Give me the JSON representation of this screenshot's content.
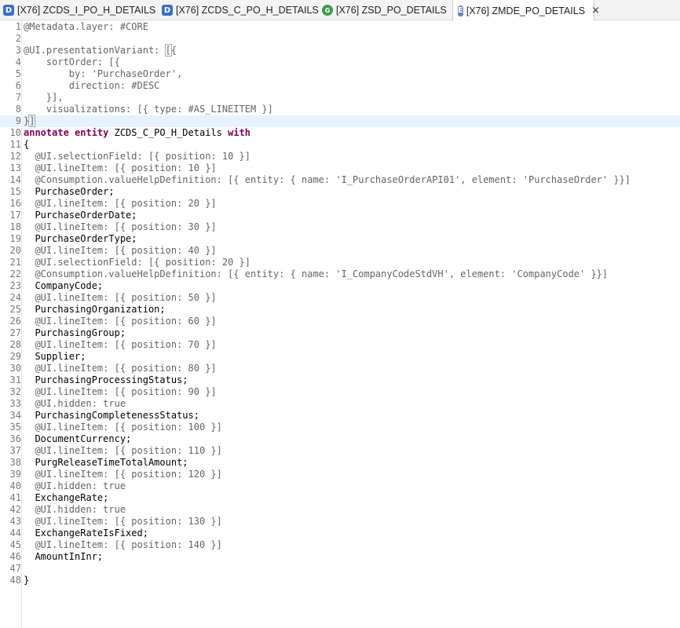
{
  "tabs": [
    {
      "icon": "D",
      "label": "[X76] ZCDS_I_PO_H_DETAILS",
      "active": false
    },
    {
      "icon": "D",
      "label": "[X76] ZCDS_C_PO_H_DETAILS",
      "active": false
    },
    {
      "icon": "G",
      "label": "[X76] ZSD_PO_DETAILS",
      "active": false
    },
    {
      "icon": "E",
      "label": "[X76] ZMDE_PO_DETAILS",
      "active": true
    }
  ],
  "tab_close_glyph": "×",
  "lines": [
    {
      "n": "1",
      "t": [
        [
          "anno",
          "@Metadata.layer: #CORE"
        ]
      ]
    },
    {
      "n": "2",
      "t": []
    },
    {
      "n": "3",
      "t": [
        [
          "anno",
          "@UI.presentationVariant: "
        ],
        [
          "anno",
          "["
        ],
        [
          "anno",
          "{"
        ]
      ]
    },
    {
      "n": "4",
      "t": [
        [
          "anno",
          "    sortOrder: [{"
        ]
      ]
    },
    {
      "n": "5",
      "t": [
        [
          "anno",
          "        by: 'PurchaseOrder',"
        ]
      ]
    },
    {
      "n": "6",
      "t": [
        [
          "anno",
          "        direction: #DESC"
        ]
      ]
    },
    {
      "n": "7",
      "t": [
        [
          "anno",
          "    }],"
        ]
      ]
    },
    {
      "n": "8",
      "t": [
        [
          "anno",
          "    visualizations: [{ type: #AS_LINEITEM }]"
        ]
      ]
    },
    {
      "n": "9",
      "t": [
        [
          "anno",
          "}"
        ],
        [
          "anno",
          "]"
        ]
      ]
    },
    {
      "n": "10",
      "t": [
        [
          "kw",
          "annotate entity"
        ],
        [
          "plain",
          " ZCDS_C_PO_H_Details "
        ],
        [
          "kw",
          "with"
        ]
      ]
    },
    {
      "n": "11",
      "t": [
        [
          "plain",
          "{"
        ]
      ]
    },
    {
      "n": "12",
      "t": [
        [
          "anno",
          "  @UI.selectionField: [{ position: 10 }]"
        ]
      ]
    },
    {
      "n": "13",
      "t": [
        [
          "anno",
          "  @UI.lineItem: [{ position: 10 }]"
        ]
      ]
    },
    {
      "n": "14",
      "t": [
        [
          "anno",
          "  @Consumption.valueHelpDefinition: [{ entity: { name: 'I_PurchaseOrderAPI01', element: 'PurchaseOrder' }}]"
        ]
      ]
    },
    {
      "n": "15",
      "t": [
        [
          "plain",
          "  PurchaseOrder;"
        ]
      ]
    },
    {
      "n": "16",
      "t": [
        [
          "anno",
          "  @UI.lineItem: [{ position: 20 }]"
        ]
      ]
    },
    {
      "n": "17",
      "t": [
        [
          "plain",
          "  PurchaseOrderDate;"
        ]
      ]
    },
    {
      "n": "18",
      "t": [
        [
          "anno",
          "  @UI.lineItem: [{ position: 30 }]"
        ]
      ]
    },
    {
      "n": "19",
      "t": [
        [
          "plain",
          "  PurchaseOrderType;"
        ]
      ]
    },
    {
      "n": "20",
      "t": [
        [
          "anno",
          "  @UI.lineItem: [{ position: 40 }]"
        ]
      ]
    },
    {
      "n": "21",
      "t": [
        [
          "anno",
          "  @UI.selectionField: [{ position: 20 }]"
        ]
      ]
    },
    {
      "n": "22",
      "t": [
        [
          "anno",
          "  @Consumption.valueHelpDefinition: [{ entity: { name: 'I_CompanyCodeStdVH', element: 'CompanyCode' }}]"
        ]
      ]
    },
    {
      "n": "23",
      "t": [
        [
          "plain",
          "  CompanyCode;"
        ]
      ]
    },
    {
      "n": "24",
      "t": [
        [
          "anno",
          "  @UI.lineItem: [{ position: 50 }]"
        ]
      ]
    },
    {
      "n": "25",
      "t": [
        [
          "plain",
          "  PurchasingOrganization;"
        ]
      ]
    },
    {
      "n": "26",
      "t": [
        [
          "anno",
          "  @UI.lineItem: [{ position: 60 }]"
        ]
      ]
    },
    {
      "n": "27",
      "t": [
        [
          "plain",
          "  PurchasingGroup;"
        ]
      ]
    },
    {
      "n": "28",
      "t": [
        [
          "anno",
          "  @UI.lineItem: [{ position: 70 }]"
        ]
      ]
    },
    {
      "n": "29",
      "t": [
        [
          "plain",
          "  Supplier;"
        ]
      ]
    },
    {
      "n": "30",
      "t": [
        [
          "anno",
          "  @UI.lineItem: [{ position: 80 }]"
        ]
      ]
    },
    {
      "n": "31",
      "t": [
        [
          "plain",
          "  PurchasingProcessingStatus;"
        ]
      ]
    },
    {
      "n": "32",
      "t": [
        [
          "anno",
          "  @UI.lineItem: [{ position: 90 }]"
        ]
      ]
    },
    {
      "n": "33",
      "t": [
        [
          "anno",
          "  @UI.hidden: true"
        ]
      ]
    },
    {
      "n": "34",
      "t": [
        [
          "plain",
          "  PurchasingCompletenessStatus;"
        ]
      ]
    },
    {
      "n": "35",
      "t": [
        [
          "anno",
          "  @UI.lineItem: [{ position: 100 }]"
        ]
      ]
    },
    {
      "n": "36",
      "t": [
        [
          "plain",
          "  DocumentCurrency;"
        ]
      ]
    },
    {
      "n": "37",
      "t": [
        [
          "anno",
          "  @UI.lineItem: [{ position: 110 }]"
        ]
      ]
    },
    {
      "n": "38",
      "t": [
        [
          "plain",
          "  PurgReleaseTimeTotalAmount;"
        ]
      ]
    },
    {
      "n": "39",
      "t": [
        [
          "anno",
          "  @UI.lineItem: [{ position: 120 }]"
        ]
      ]
    },
    {
      "n": "40",
      "t": [
        [
          "anno",
          "  @UI.hidden: true"
        ]
      ]
    },
    {
      "n": "41",
      "t": [
        [
          "plain",
          "  ExchangeRate;"
        ]
      ]
    },
    {
      "n": "42",
      "t": [
        [
          "anno",
          "  @UI.hidden: true"
        ]
      ]
    },
    {
      "n": "43",
      "t": [
        [
          "anno",
          "  @UI.lineItem: [{ position: 130 }]"
        ]
      ]
    },
    {
      "n": "44",
      "t": [
        [
          "plain",
          "  ExchangeRateIsFixed;"
        ]
      ]
    },
    {
      "n": "45",
      "t": [
        [
          "anno",
          "  @UI.lineItem: [{ position: 140 }]"
        ]
      ]
    },
    {
      "n": "46",
      "t": [
        [
          "plain",
          "  AmountInInr;"
        ]
      ]
    },
    {
      "n": "47",
      "t": []
    },
    {
      "n": "48",
      "t": [
        [
          "plain",
          "}"
        ]
      ]
    }
  ],
  "current_line": "9",
  "colors": {
    "annotation": "#646464",
    "keyword": "#7f0055",
    "current_line_bg": "#e8f2fe"
  }
}
